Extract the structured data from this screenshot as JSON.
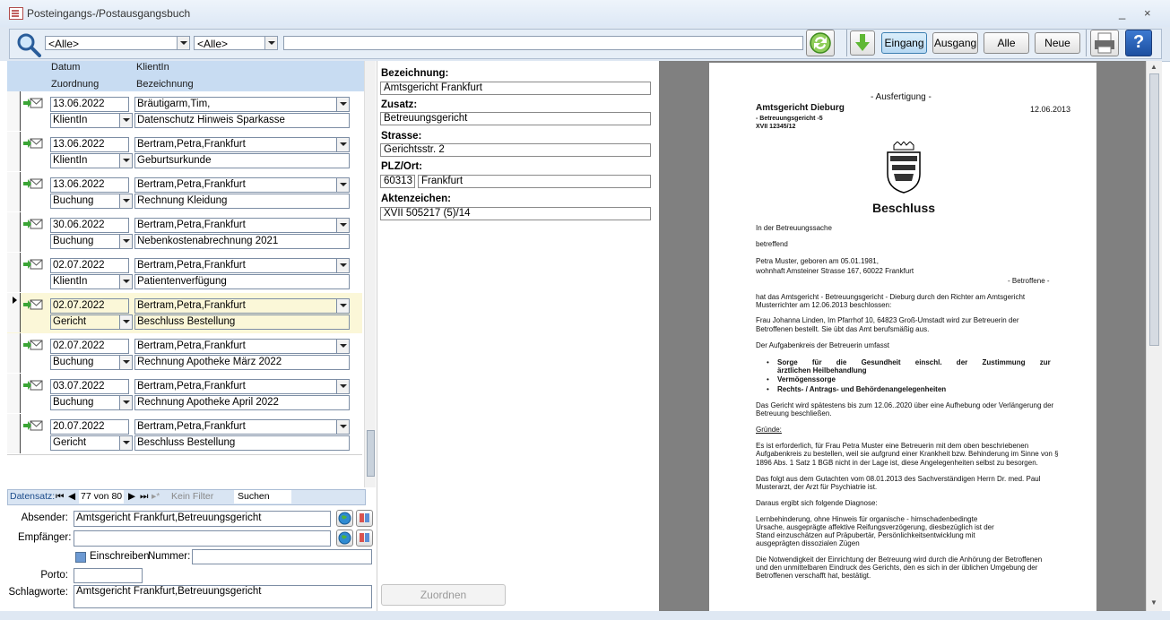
{
  "window": {
    "title": "Posteingangs-/Postausgangsbuch",
    "minimize": "_",
    "close": "×"
  },
  "toolbar": {
    "filter1": "<Alle>",
    "filter2": "<Alle>",
    "search_value": "",
    "eingang_label": "Eingang",
    "ausgang_label": "Ausgang",
    "alle_label": "Alle",
    "neue_label": "Neue"
  },
  "list": {
    "headers": {
      "datum": "Datum",
      "klientin": "KlientIn",
      "zuordnung": "Zuordnung",
      "bezeichnung": "Bezeichnung"
    },
    "rows": [
      {
        "date": "13.06.2022",
        "client": "Bräutigarm,Tim,",
        "assign": "KlientIn",
        "desc": "Datenschutz Hinweis Sparkasse"
      },
      {
        "date": "13.06.2022",
        "client": "Bertram,Petra,Frankfurt",
        "assign": "KlientIn",
        "desc": "Geburtsurkunde"
      },
      {
        "date": "13.06.2022",
        "client": "Bertram,Petra,Frankfurt",
        "assign": "Buchung",
        "desc": "Rechnung Kleidung"
      },
      {
        "date": "30.06.2022",
        "client": "Bertram,Petra,Frankfurt",
        "assign": "Buchung",
        "desc": "Nebenkostenabrechnung 2021"
      },
      {
        "date": "02.07.2022",
        "client": "Bertram,Petra,Frankfurt",
        "assign": "KlientIn",
        "desc": "Patientenverfügung"
      },
      {
        "date": "02.07.2022",
        "client": "Bertram,Petra,Frankfurt",
        "assign": "Gericht",
        "desc": "Beschluss Bestellung"
      },
      {
        "date": "02.07.2022",
        "client": "Bertram,Petra,Frankfurt",
        "assign": "Buchung",
        "desc": "Rechnung Apotheke März 2022"
      },
      {
        "date": "03.07.2022",
        "client": "Bertram,Petra,Frankfurt",
        "assign": "Buchung",
        "desc": "Rechnung Apotheke April 2022"
      },
      {
        "date": "20.07.2022",
        "client": "Bertram,Petra,Frankfurt",
        "assign": "Gericht",
        "desc": "Beschluss Bestellung"
      }
    ],
    "selected_index": 5
  },
  "navbar": {
    "label": "Datensatz:",
    "position": "77 von 80",
    "nofilter": "Kein Filter",
    "search": "Suchen"
  },
  "form": {
    "absender_label": "Absender:",
    "absender_value": "Amtsgericht Frankfurt,Betreuungsgericht",
    "empfaenger_label": "Empfänger:",
    "empfaenger_value": "",
    "einschreiben_label": "Einschreiben",
    "nummer_label": "Nummer:",
    "porto_label": "Porto:",
    "schlagworte_label": "Schlagworte:",
    "schlagworte_value": "Amtsgericht Frankfurt,Betreuungsgericht"
  },
  "detail": {
    "bezeichnung_label": "Bezeichnung:",
    "bezeichnung_value": "Amtsgericht Frankfurt",
    "zusatz_label": "Zusatz:",
    "zusatz_value": "Betreuungsgericht",
    "strasse_label": "Strasse:",
    "strasse_value": "Gerichtsstr. 2",
    "plz_label": "PLZ/Ort:",
    "plz_value": "60313",
    "ort_value": "Frankfurt",
    "aktenzeichen_label": "Aktenzeichen:",
    "aktenzeichen_value": "XVII 505217 (5)/14",
    "zuordnen_label": "Zuordnen"
  },
  "document": {
    "ausfertigung": "- Ausfertigung -",
    "court": "Amtsgericht Dieburg",
    "date": "12.06.2013",
    "sub1": "- Betreuungsgericht -5",
    "sub2": "XVII 12345/12",
    "title": "Beschluss",
    "l1": "In der Betreuungssache",
    "l2": "betreffend",
    "l3": "Petra Muster, geboren am 05.01.1981,",
    "l4": "wohnhaft Amsteiner Strasse 167, 60022 Frankfurt",
    "l5": "- Betroffene -",
    "p1a": "hat das Amtsgericht - Betreuungsgericht - Dieburg durch den Richter am Amtsgericht",
    "p1b": "Musterrichter am 12.06.2013 beschlossen:",
    "p2a": "Frau Johanna Linden, Im Pfarrhof 10, 64823 Groß-Umstadt wird zur Betreuerin der",
    "p2b": "Betroffenen bestellt. Sie übt das Amt berufsmäßig aus.",
    "p3": "Der Aufgabenkreis der Betreuerin umfasst",
    "b1a": "Sorge für die Gesundheit einschl. der Zustimmung zur",
    "b1b": "ärztlichen Heilbehandlung",
    "b2": "Vermögenssorge",
    "b3": "Rechts- / Antrags- und Behördenangelegenheiten",
    "p4a": "Das Gericht wird spätestens bis zum 12.06..2020 über eine Aufhebung oder Verlängerung der",
    "p4b": "Betreuung beschließen.",
    "gruende": "Gründe:",
    "p5a": "Es ist erforderlich, für Frau Petra Muster eine Betreuerin mit dem oben beschriebenen",
    "p5b": "Aufgabenkreis zu bestellen, weil sie aufgrund einer Krankheit bzw. Behinderung im Sinne von §",
    "p5c": "1896 Abs. 1 Satz 1 BGB nicht in der Lage ist, diese Angelegenheiten selbst zu besorgen.",
    "p6a": "Das folgt aus dem Gutachten vom 08.01.2013 des Sachverständigen Herrn Dr. med. Paul",
    "p6b": "Musterarzt, der Arzt für Psychiatrie ist.",
    "p7": "Daraus ergibt sich folgende Diagnose:",
    "p8a": "Lernbehinderung, ohne Hinweis für organische - hirnschadenbedingte",
    "p8b": "Ursache, ausgeprägte affektive Reifungsverzögerung, diesbezüglich ist der",
    "p8c": "Stand einzuschätzen auf Präpubertär, Persönlichkeitsentwicklung mit",
    "p8d": "ausgeprägten dissozialen Zügen",
    "p9a": "Die Notwendigkeit der Einrichtung der Betreuung wird durch die Anhörung der Betroffenen",
    "p9b": "und den unmittelbaren Eindruck des Gerichts, den es sich in der üblichen Umgebung der",
    "p9c": "Betroffenen verschafft hat, bestätigt."
  }
}
